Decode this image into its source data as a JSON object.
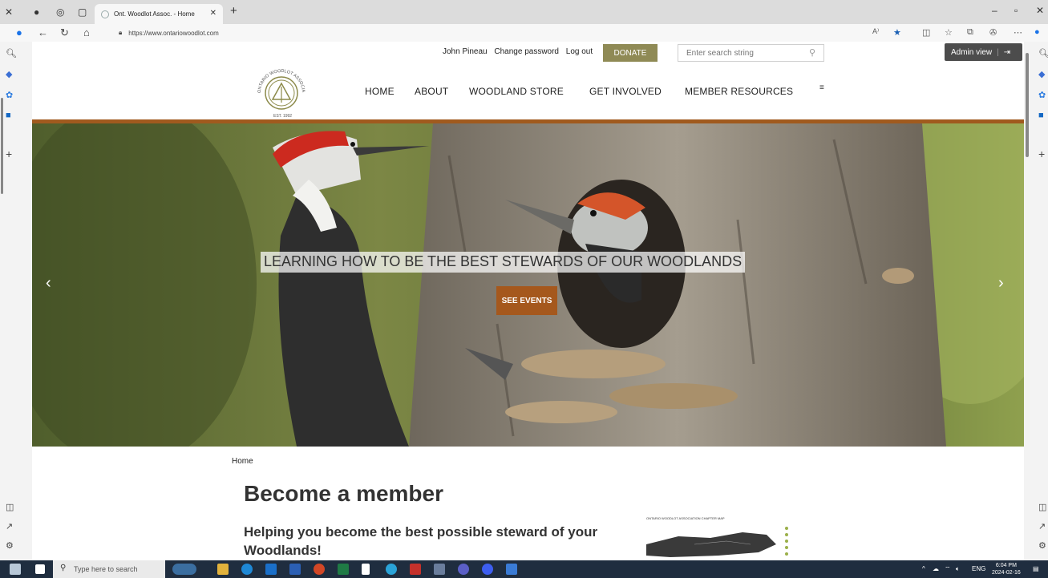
{
  "browser": {
    "tab_title": "Ont. Woodlot Assoc. - Home",
    "url": "https://www.ontariowoodlot.com",
    "admin_view_label": "Admin view"
  },
  "site": {
    "user_name": "John Pineau",
    "change_password": "Change password",
    "logout": "Log out",
    "donate": "DONATE",
    "search_placeholder": "Enter search string",
    "logo_text": {
      "arc": "ONTARIO WOODLOT ASSOCIATION",
      "est": "EST. 1992"
    },
    "nav": [
      "HOME",
      "ABOUT",
      "WOODLAND STORE",
      "GET INVOLVED",
      "MEMBER RESOURCES"
    ],
    "hero": {
      "title": "LEARNING HOW TO BE THE BEST STEWARDS OF OUR WOODLANDS",
      "button": "SEE EVENTS",
      "slide_count": 5,
      "active_slide": 1
    },
    "breadcrumb": "Home",
    "heading": "Become a member",
    "subheading": "Helping you become the best possible steward of your Woodlands!",
    "map_caption": "ONTARIO WOODLOT ASSOCIATION CHAPTER MAP"
  },
  "taskbar": {
    "search_placeholder": "Type here to search",
    "lang": "ENG",
    "time": "6:04 PM",
    "date": "2024-02-16"
  },
  "colors": {
    "donate": "#8f8a55",
    "hero_border": "#a05a1e",
    "hero_button": "#a5581d",
    "admin": "#4c4c4c",
    "taskbar": "#1f2d3f"
  }
}
